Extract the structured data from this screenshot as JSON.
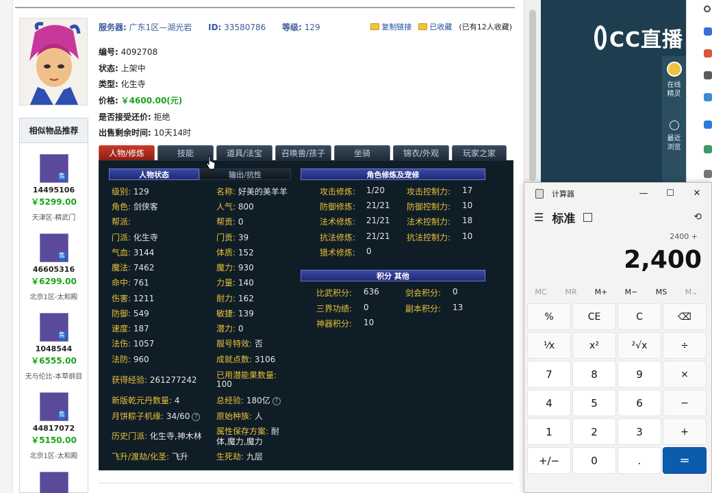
{
  "header": {
    "server_label": "服务器:",
    "server_value": "广东1区—湖光岩",
    "id_label": "ID:",
    "id_value": "33580786",
    "level_label": "等级:",
    "level_value": "129",
    "copy_link": "复制链接",
    "collected": "已收藏",
    "collect_count": "(已有12人收藏)"
  },
  "item": {
    "no_label": "编号:",
    "no_value": "4092708",
    "status_label": "状态:",
    "status_value": "上架中",
    "type_label": "类型:",
    "type_value": "化生寺",
    "price_label": "价格:",
    "price_value": "￥4600.00(元)",
    "counter_label": "是否接受还价:",
    "counter_value": "拒绝",
    "time_label": "出售剩余时间:",
    "time_value": "10天14时"
  },
  "sidebar": {
    "title": "相似物品推荐",
    "items": [
      {
        "id": "14495106",
        "price": "￥5299.00",
        "server": "天津区-精武门"
      },
      {
        "id": "46605316",
        "price": "￥6299.00",
        "server": "北京1区-太和殿"
      },
      {
        "id": "1048544",
        "price": "￥6555.00",
        "server": "无与伦比-本草纲目"
      },
      {
        "id": "44817072",
        "price": "￥5150.00",
        "server": "北京1区-太和殿"
      }
    ],
    "sale_badge": "售"
  },
  "tabs": [
    "人物/修炼",
    "技能",
    "道具/法宝",
    "召唤兽/孩子",
    "坐骑",
    "锦衣/外观",
    "玩家之家"
  ],
  "panel": {
    "sec_status": "人物状态",
    "sec_output": "输出/抗性",
    "sec_cultivation": "角色修炼及宠修",
    "sec_points": "积分 其他",
    "left": [
      {
        "k": "级别:",
        "v": "129"
      },
      {
        "k": "角色:",
        "v": "剑侠客"
      },
      {
        "k": "帮派:",
        "v": ""
      },
      {
        "k": "门派:",
        "v": "化生寺"
      },
      {
        "k": "气血:",
        "v": "3144"
      },
      {
        "k": "魔法:",
        "v": "7462"
      },
      {
        "k": "命中:",
        "v": "761"
      },
      {
        "k": "伤害:",
        "v": "1211"
      },
      {
        "k": "防御:",
        "v": "549"
      },
      {
        "k": "速度:",
        "v": "187"
      },
      {
        "k": "法伤:",
        "v": "1057"
      },
      {
        "k": "法防:",
        "v": "960"
      }
    ],
    "mid": [
      {
        "k": "名称:",
        "v": "好美的美羊羊"
      },
      {
        "k": "人气:",
        "v": "800"
      },
      {
        "k": "帮贡:",
        "v": "0"
      },
      {
        "k": "门贡:",
        "v": "39"
      },
      {
        "k": "体质:",
        "v": "152"
      },
      {
        "k": "魔力:",
        "v": "930"
      },
      {
        "k": "力量:",
        "v": "140"
      },
      {
        "k": "耐力:",
        "v": "162"
      },
      {
        "k": "敏捷:",
        "v": "139"
      },
      {
        "k": "潜力:",
        "v": "0"
      },
      {
        "k": "靓号特效:",
        "v": "否"
      },
      {
        "k": "成就点数:",
        "v": "3106"
      }
    ],
    "exp_label": "获得经验:",
    "exp_value": "261277242",
    "pot_label": "已用潜能果数量:",
    "pot_value": "100",
    "pill_label": "新版乾元丹数量:",
    "pill_value": "4",
    "total_exp_label": "总经验:",
    "total_exp_value": "180亿",
    "mooncake_label": "月饼粽子机缘:",
    "mooncake_value": "34/60",
    "race_label": "原始种族:",
    "race_value": "人",
    "hist_label": "历史门派:",
    "hist_value": "化生寺,神木林",
    "attr_label": "属性保存方案:",
    "attr_value1": "耐",
    "attr_value2": "体,魔力,魔力",
    "fly_label": "飞升/渡劫/化圣:",
    "fly_value": "飞升",
    "life_label": "生死劫:",
    "life_value": "九层",
    "cult": [
      {
        "k": "攻击修炼:",
        "v": "1/20",
        "k2": "攻击控制力:",
        "v2": "17"
      },
      {
        "k": "防御修炼:",
        "v": "21/21",
        "k2": "防御控制力:",
        "v2": "10"
      },
      {
        "k": "法术修炼:",
        "v": "21/21",
        "k2": "法术控制力:",
        "v2": "18"
      },
      {
        "k": "抗法修炼:",
        "v": "21/21",
        "k2": "抗法控制力:",
        "v2": "10"
      },
      {
        "k": "猎术修炼:",
        "v": "0",
        "k2": "",
        "v2": ""
      }
    ],
    "points": [
      {
        "k": "比武积分:",
        "v": "636",
        "k2": "剑会积分:",
        "v2": "0"
      },
      {
        "k": "三界功绩:",
        "v": "0",
        "k2": "副本积分:",
        "v2": "13"
      },
      {
        "k": "神器积分:",
        "v": "10",
        "k2": "",
        "v2": ""
      }
    ]
  },
  "cc": {
    "logo": "CC直播",
    "online_label": "在线\n精灵",
    "recent_label": "最近\n浏览"
  },
  "calculator": {
    "title": "计算器",
    "mode": "标准",
    "expression": "2400 +",
    "display": "2,400",
    "memory": [
      "MC",
      "MR",
      "M+",
      "M−",
      "MS",
      "M⌄"
    ],
    "keys": [
      "%",
      "CE",
      "C",
      "⌫",
      "⅟x",
      "x²",
      "²√x",
      "÷",
      "7",
      "8",
      "9",
      "×",
      "4",
      "5",
      "6",
      "−",
      "1",
      "2",
      "3",
      "+",
      "+/−",
      "0",
      ".",
      "="
    ],
    "minimize": "—",
    "maximize": "☐",
    "close": "✕"
  }
}
